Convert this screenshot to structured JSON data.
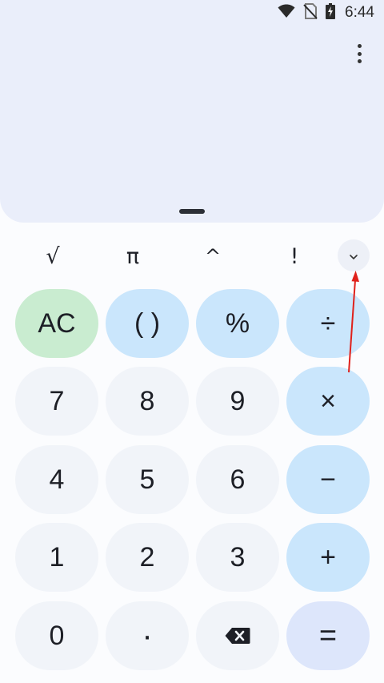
{
  "status_bar": {
    "time": "6:44",
    "icons": [
      "wifi-icon",
      "no-sim-icon",
      "battery-charging-icon"
    ]
  },
  "display": {
    "menu_icon": "more-vert-icon",
    "handle_icon": "drag-handle"
  },
  "scientific_row": {
    "sqrt": "√",
    "pi": "π",
    "power": "^",
    "factorial": "!",
    "expand_icon": "chevron-down-icon"
  },
  "keypad": {
    "clear": "AC",
    "parentheses": "( )",
    "percent": "%",
    "divide": "÷",
    "seven": "7",
    "eight": "8",
    "nine": "9",
    "multiply": "×",
    "four": "4",
    "five": "5",
    "six": "6",
    "minus": "−",
    "one": "1",
    "two": "2",
    "three": "3",
    "plus": "+",
    "zero": "0",
    "decimal": "·",
    "backspace_icon": "backspace-icon",
    "equals": "="
  },
  "colors": {
    "display_bg": "#eaeefa",
    "number_key": "#f1f4f9",
    "operator_key": "#cae6fc",
    "clear_key": "#c9ecd0",
    "equals_key": "#dde6fb",
    "annotation_arrow": "#e0211b"
  }
}
